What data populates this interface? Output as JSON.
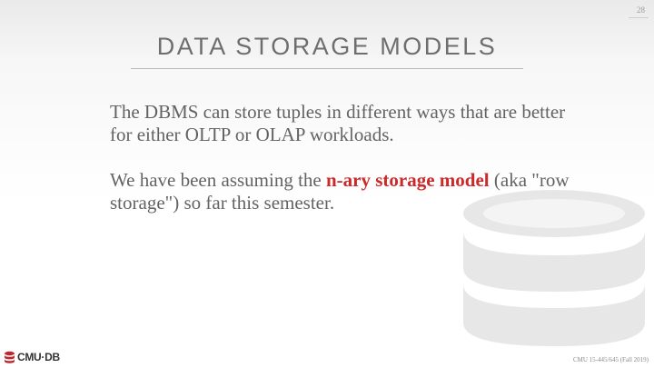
{
  "slide": {
    "page_number": "28",
    "title": "DATA STORAGE MODELS",
    "paragraph1": "The DBMS can store tuples in different ways that are better for either OLTP or OLAP workloads.",
    "paragraph2_before": "We have been assuming the ",
    "paragraph2_highlight": "n-ary storage model",
    "paragraph2_after": " (aka \"row storage\") so far this semester.",
    "highlight_color": "#cc2a2a"
  },
  "footer": {
    "logo_text": "CMU·DB",
    "logo_icon": "database-cylinder-icon",
    "course": "CMU 15-445/645 (Fall 2019)"
  }
}
